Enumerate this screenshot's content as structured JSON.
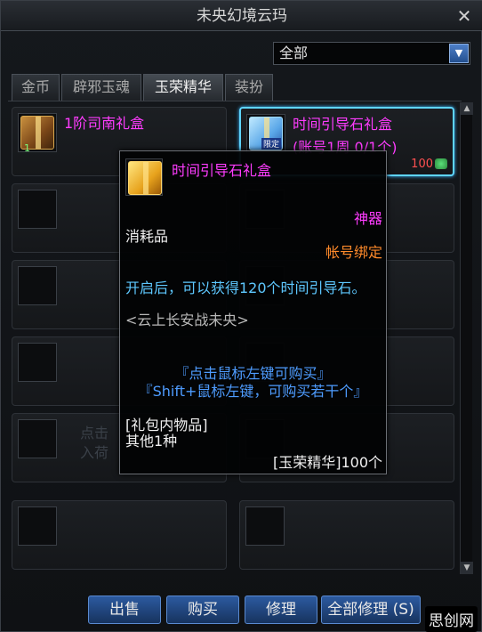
{
  "window": {
    "title": "未央幻境云玛",
    "close_glyph": "✕"
  },
  "filter": {
    "selected": "全部"
  },
  "tabs": [
    "金币",
    "辟邪玉魂",
    "玉荣精华",
    "装扮"
  ],
  "active_tab_index": 2,
  "items": [
    {
      "name": "1阶司南礼盒",
      "subtitle": "",
      "count": "1",
      "icon": "gift-box-bronze-icon"
    },
    {
      "name": "时间引导石礼盒",
      "subtitle": "(账号1周 0/1个)",
      "price": "100",
      "badge": "限定",
      "icon": "gift-box-blue-icon"
    }
  ],
  "tooltip": {
    "title": "时间引导石礼盒",
    "grade": "神器",
    "type": "消耗品",
    "bind": "帐号绑定",
    "description": "开启后，可以获得120个时间引导石。",
    "source": "<云上长安战未央>",
    "hint_line1": "『点击鼠标左键可购买』",
    "hint_line2": "『Shift+鼠标左键，可购买若干个』",
    "contents_label": "[礼包内物品]",
    "contents_value": "其他1种",
    "cost": "[玉荣精华]100个"
  },
  "background_fragments": [
    "点击",
    "入荷"
  ],
  "buttons": [
    "出售",
    "购买",
    "修理",
    "全部修理 (S)"
  ],
  "watermark": "思创网",
  "colors": {
    "item_name": "#ff3cff",
    "grade": "#ff3cff",
    "bind": "#ff8a2a",
    "description": "#5ec8ff",
    "hint": "#4e9cff",
    "price": "#ff5050"
  }
}
